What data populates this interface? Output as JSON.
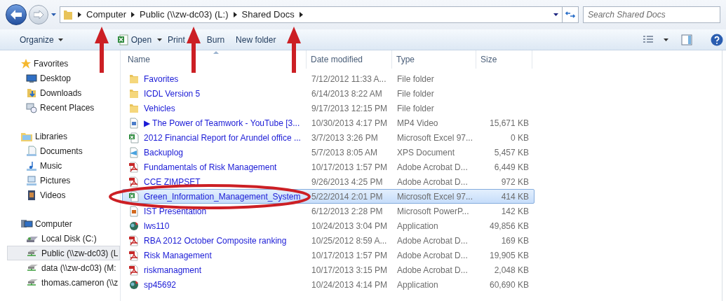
{
  "address_bar": {
    "breadcrumbs": [
      "Computer",
      "Public (\\\\zw-dc03) (L:)",
      "Shared Docs"
    ],
    "search": {
      "placeholder": "Search Shared Docs"
    }
  },
  "toolbar": [
    {
      "label": "Organize",
      "kind": "menu"
    },
    {
      "label": "Open",
      "kind": "excel_menu"
    },
    {
      "label": "Print",
      "kind": "button"
    },
    {
      "label": "Burn",
      "kind": "button"
    },
    {
      "label": "New folder",
      "kind": "button"
    }
  ],
  "sidebar": [
    {
      "label": "Favorites",
      "kind": "star",
      "items": [
        {
          "label": "Desktop",
          "kind": "desktop",
          "selected": false
        },
        {
          "label": "Downloads",
          "kind": "downloads",
          "selected": false
        },
        {
          "label": "Recent Places",
          "kind": "recent",
          "selected": false
        }
      ]
    },
    {
      "label": "Libraries",
      "kind": "library",
      "items": [
        {
          "label": "Documents",
          "kind": "documents",
          "selected": false
        },
        {
          "label": "Music",
          "kind": "music",
          "selected": false
        },
        {
          "label": "Pictures",
          "kind": "pictures",
          "selected": false
        },
        {
          "label": "Videos",
          "kind": "videos",
          "selected": false
        }
      ]
    },
    {
      "label": "Computer",
      "kind": "computer",
      "items": [
        {
          "label": "Local Disk (C:)",
          "kind": "disk",
          "selected": false
        },
        {
          "label": "Public (\\\\zw-dc03) (L",
          "kind": "netdrive",
          "selected": true
        },
        {
          "label": "data (\\\\zw-dc03) (M:",
          "kind": "netdrive",
          "selected": false
        },
        {
          "label": "thomas.cameron (\\\\z",
          "kind": "netdrive",
          "selected": false
        }
      ]
    }
  ],
  "columns": [
    {
      "label": "Name",
      "sorted": true
    },
    {
      "label": "Date modified",
      "sorted": false
    },
    {
      "label": "Type",
      "sorted": false
    },
    {
      "label": "Size",
      "sorted": false
    }
  ],
  "rows": [
    {
      "name": "Favorites",
      "date": "7/12/2012 11:33 A...",
      "type": "File folder",
      "kind": "folder",
      "selected": false
    },
    {
      "name": "ICDL Version 5",
      "date": "6/14/2013 8:22 AM",
      "type": "File folder",
      "kind": "folder",
      "selected": false
    },
    {
      "name": "Vehicles",
      "date": "9/17/2013 12:15 PM",
      "type": "File folder",
      "kind": "folder",
      "selected": false
    },
    {
      "name": "▶ The Power of Teamwork - YouTube [3...",
      "date": "10/30/2013 4:17 PM",
      "type": "MP4 Video",
      "size": "15,671 KB",
      "kind": "video",
      "selected": false
    },
    {
      "name": "2012  Financial Report for Arundel office ...",
      "date": "3/7/2013 3:26 PM",
      "type": "Microsoft Excel 97...",
      "size": "0 KB",
      "kind": "excel",
      "selected": false
    },
    {
      "name": "Backuplog",
      "date": "5/7/2013 8:05 AM",
      "type": "XPS Document",
      "size": "5,457 KB",
      "kind": "xps",
      "selected": false
    },
    {
      "name": "Fundamentals of Risk Management",
      "date": "10/17/2013 1:57 PM",
      "type": "Adobe Acrobat D...",
      "size": "6,449 KB",
      "kind": "pdf",
      "selected": false
    },
    {
      "name": "CCE ZIMPSET",
      "date": "9/26/2013 4:25 PM",
      "type": "Adobe Acrobat D...",
      "size": "972 KB",
      "kind": "pdf",
      "selected": false
    },
    {
      "name": "Green_Information_Management_System",
      "date": "5/22/2014 2:01 PM",
      "type": "Microsoft Excel 97...",
      "size": "414 KB",
      "kind": "excel",
      "selected": true
    },
    {
      "name": "IST Presentation",
      "date": "6/12/2013 2:28 PM",
      "type": "Microsoft PowerP...",
      "size": "142 KB",
      "kind": "ppt",
      "selected": false
    },
    {
      "name": "lws110",
      "date": "10/24/2013 3:04 PM",
      "type": "Application",
      "size": "49,856 KB",
      "kind": "app",
      "selected": false
    },
    {
      "name": "RBA 2012 October Composite ranking",
      "date": "10/25/2012 8:59 A...",
      "type": "Adobe Acrobat D...",
      "size": "169 KB",
      "kind": "pdf",
      "selected": false
    },
    {
      "name": "Risk Management",
      "date": "10/17/2013 1:57 PM",
      "type": "Adobe Acrobat D...",
      "size": "19,905 KB",
      "kind": "pdf",
      "selected": false
    },
    {
      "name": "riskmanagment",
      "date": "10/17/2013 3:15 PM",
      "type": "Adobe Acrobat D...",
      "size": "2,048 KB",
      "kind": "pdf",
      "selected": false
    },
    {
      "name": "sp45692",
      "date": "10/24/2013 4:14 PM",
      "type": "Application",
      "size": "60,690 KB",
      "kind": "app",
      "selected": false
    }
  ]
}
